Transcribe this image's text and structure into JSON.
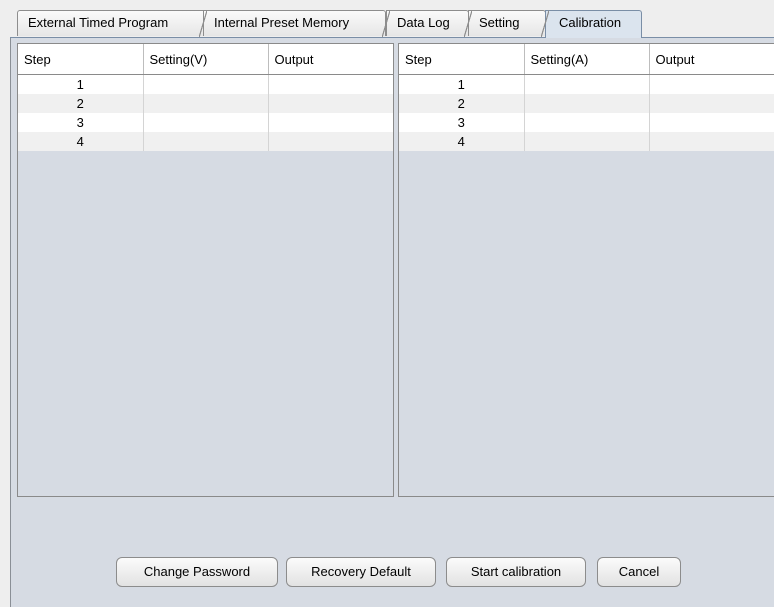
{
  "tabs": [
    {
      "label": "External Timed Program"
    },
    {
      "label": "Internal Preset Memory"
    },
    {
      "label": "Data Log"
    },
    {
      "label": "Setting"
    },
    {
      "label": "Calibration",
      "active": true
    }
  ],
  "voltage_table": {
    "columns": [
      "Step",
      "Setting(V)",
      "Output"
    ],
    "rows": [
      {
        "step": "1",
        "setting": "",
        "output": ""
      },
      {
        "step": "2",
        "setting": "",
        "output": ""
      },
      {
        "step": "3",
        "setting": "",
        "output": ""
      },
      {
        "step": "4",
        "setting": "",
        "output": ""
      }
    ]
  },
  "current_table": {
    "columns": [
      "Step",
      "Setting(A)",
      "Output"
    ],
    "rows": [
      {
        "step": "1",
        "setting": "",
        "output": ""
      },
      {
        "step": "2",
        "setting": "",
        "output": ""
      },
      {
        "step": "3",
        "setting": "",
        "output": ""
      },
      {
        "step": "4",
        "setting": "",
        "output": ""
      }
    ]
  },
  "buttons": {
    "change_password": "Change Password",
    "recovery_default": "Recovery Default",
    "start_calibration": "Start calibration",
    "cancel": "Cancel"
  }
}
